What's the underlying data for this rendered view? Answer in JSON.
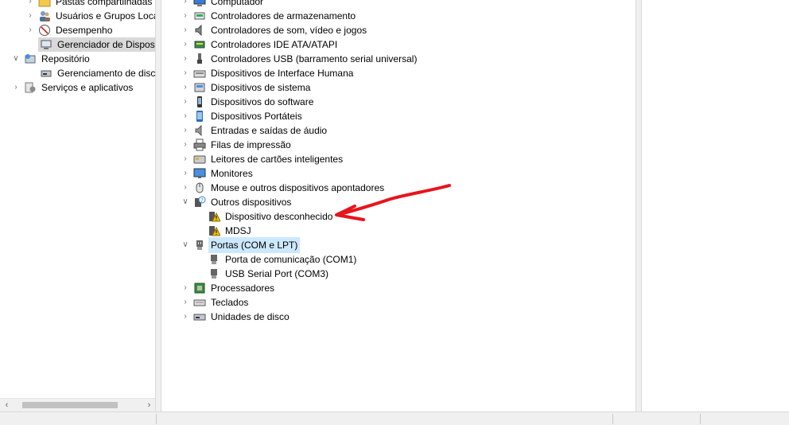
{
  "left_tree": {
    "items": [
      {
        "label": "Pastas compartilhadas",
        "icon": "shared-folder-icon"
      },
      {
        "label": "Usuários e Grupos Loca",
        "icon": "users-groups-icon"
      },
      {
        "label": "Desempenho",
        "icon": "performance-icon"
      },
      {
        "label": "Gerenciador de Disposit",
        "icon": "device-manager-icon"
      },
      {
        "label": "Repositório",
        "icon": "storage-icon"
      },
      {
        "label": "Gerenciamento de disco",
        "icon": "disk-management-icon"
      },
      {
        "label": "Serviços e aplicativos",
        "icon": "services-icon"
      }
    ]
  },
  "device_tree": {
    "categories": [
      {
        "label": "Computador",
        "icon": "computer-icon"
      },
      {
        "label": "Controladores de armazenamento",
        "icon": "storage-controller-icon"
      },
      {
        "label": "Controladores de som, vídeo e jogos",
        "icon": "speaker-icon"
      },
      {
        "label": "Controladores IDE ATA/ATAPI",
        "icon": "ide-controller-icon"
      },
      {
        "label": "Controladores USB (barramento serial universal)",
        "icon": "usb-icon"
      },
      {
        "label": "Dispositivos de Interface Humana",
        "icon": "hid-icon"
      },
      {
        "label": "Dispositivos de sistema",
        "icon": "system-device-icon"
      },
      {
        "label": "Dispositivos do software",
        "icon": "software-device-icon"
      },
      {
        "label": "Dispositivos Portáteis",
        "icon": "portable-device-icon"
      },
      {
        "label": "Entradas e saídas de áudio",
        "icon": "audio-io-icon"
      },
      {
        "label": "Filas de impressão",
        "icon": "printer-icon"
      },
      {
        "label": "Leitores de cartões inteligentes",
        "icon": "smart-card-icon"
      },
      {
        "label": "Monitores",
        "icon": "monitor-icon"
      },
      {
        "label": "Mouse e outros dispositivos apontadores",
        "icon": "mouse-icon"
      },
      {
        "label": "Outros dispositivos",
        "icon": "unknown-device-icon"
      },
      {
        "label": "Portas (COM e LPT)",
        "icon": "port-icon"
      },
      {
        "label": "Processadores",
        "icon": "processor-icon"
      },
      {
        "label": "Teclados",
        "icon": "keyboard-icon"
      },
      {
        "label": "Unidades de disco",
        "icon": "disk-drive-icon"
      }
    ],
    "other_devices": [
      {
        "label": "Dispositivo desconhecido",
        "icon": "warning-device-icon"
      },
      {
        "label": "MDSJ",
        "icon": "warning-device-icon"
      }
    ],
    "ports": [
      {
        "label": "Porta de comunicação (COM1)",
        "icon": "port-icon"
      },
      {
        "label": "USB Serial Port (COM3)",
        "icon": "port-icon"
      }
    ]
  },
  "colors": {
    "selection_gray": "#d9d9d9",
    "selection_blue": "#cce8ff",
    "annotation_arrow": "#e8141c",
    "warning_yellow": "#f5c400"
  }
}
